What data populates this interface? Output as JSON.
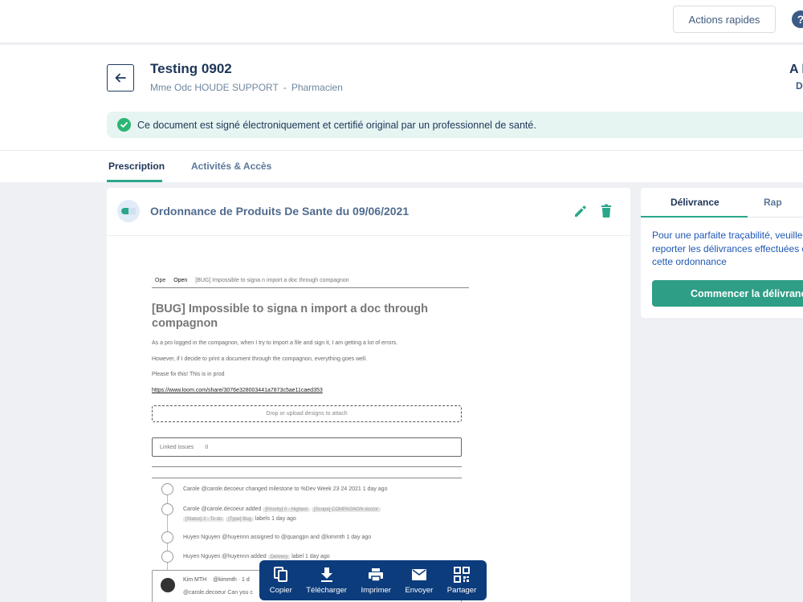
{
  "topbar": {
    "quick_actions_label": "Actions rapides",
    "help_glyph": "?"
  },
  "header": {
    "title": "Testing 0902",
    "author": "Mme Odc HOUDE SUPPORT",
    "separator": "-",
    "role": "Pharmacien",
    "right_title_partial": "A l",
    "right_sub_partial": "D"
  },
  "banner": {
    "text": "Ce document est signé électroniquement et certifié original par un professionnel de santé."
  },
  "tabs": [
    {
      "label": "Prescription"
    },
    {
      "label": "Activités & Accès"
    }
  ],
  "card": {
    "title": "Ordonnance de Produits De Sante du 09/06/2021"
  },
  "preview": {
    "tab_ope": "Ope",
    "tab_open": "Open",
    "tab_issue": "[BUG] Impossible to signa n import a doc through compagnon",
    "title": "[BUG] Impossible to signa n import a doc through compagnon",
    "p1": "As a pro logged in the compagnon, when I try to import a file and sign it, I am getting a lot of errors.",
    "p2": "However, if I decide to print a document through the compagnon, everything goes well.",
    "p3": "Please fix this! This is in prod",
    "link": "https://www.loom.com/share/3076e328003441a7873c5ae11caed353",
    "dropzone": "Drop or upload designs to attach",
    "linked_issues": "Linked issues",
    "linked_count": "0",
    "timeline": [
      {
        "text": "Carole @carole.decoeur changed milestone to %Dev Week 23 24 2021 1 day ago"
      },
      {
        "text": "Carole @carole.decoeur added",
        "tags": [
          "[Priority] 0 - Highest",
          "[Scope] COMPAGNON doctor",
          "[Status] 2 - To do",
          "[Type] Bug"
        ],
        "suffix": "labels 1 day ago"
      },
      {
        "text": "Huyen Nguyen @huyennn assigned to @quangpn and @kimmth 1 day ago"
      },
      {
        "text": "Huyen Nguyen @huyennn added",
        "tags": [
          "Delivery"
        ],
        "suffix": "label 1 day ago"
      }
    ],
    "comment_author": "Kim MTH",
    "comment_handle": "@kimmth · 1 d",
    "comment_body": "@carole.decoeur  Can you c"
  },
  "toolbar": {
    "items": [
      {
        "label": "Copier",
        "icon": "copy-icon"
      },
      {
        "label": "Télécharger",
        "icon": "download-icon"
      },
      {
        "label": "Imprimer",
        "icon": "print-icon"
      },
      {
        "label": "Envoyer",
        "icon": "mail-icon"
      },
      {
        "label": "Partager",
        "icon": "qr-code-icon"
      }
    ]
  },
  "side": {
    "tab_delivery": "Délivrance",
    "tab_rap_partial": "Rap",
    "text": "Pour une parfaite traçabilité, veuillez reporter les délivrances effectuées de cette ordonnance",
    "button": "Commencer la délivrance"
  },
  "colors": {
    "accent_green": "#2aa78b",
    "navy": "#0c3c7c",
    "banner_bg": "#e6f5f2",
    "check_green": "#2bb673"
  }
}
